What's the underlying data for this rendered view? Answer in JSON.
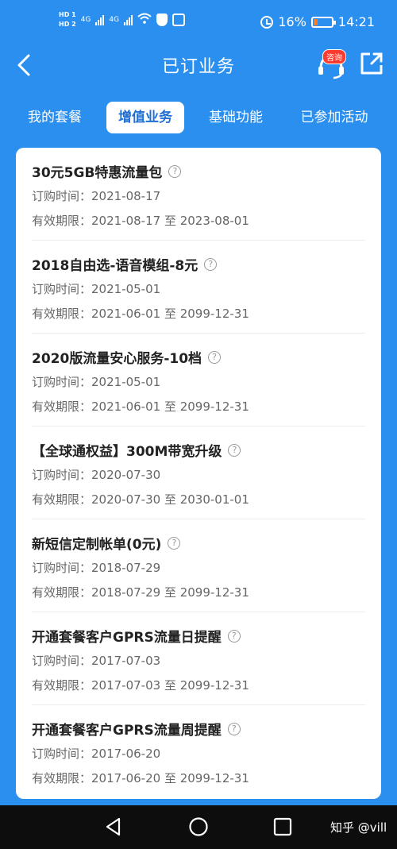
{
  "status_bar": {
    "hd1": "HD 1",
    "hd2": "HD 2",
    "network1": "4G",
    "network2": "4G",
    "battery_percent": "16%",
    "time": "14:21"
  },
  "header": {
    "title": "已订业务",
    "consult_badge": "咨询"
  },
  "tabs": [
    {
      "label": "我的套餐",
      "active": false
    },
    {
      "label": "增值业务",
      "active": true
    },
    {
      "label": "基础功能",
      "active": false
    },
    {
      "label": "已参加活动",
      "active": false
    }
  ],
  "services": [
    {
      "name": "30元5GB特惠流量包",
      "order_time": "订购时间：2021-08-17",
      "validity": "有效期限：2021-08-17 至 2023-08-01"
    },
    {
      "name": "2018自由选-语音模组-8元",
      "order_time": "订购时间：2021-05-01",
      "validity": "有效期限：2021-06-01 至 2099-12-31"
    },
    {
      "name": "2020版流量安心服务-10档",
      "order_time": "订购时间：2021-05-01",
      "validity": "有效期限：2021-06-01 至 2099-12-31"
    },
    {
      "name": "【全球通权益】300M带宽升级",
      "order_time": "订购时间：2020-07-30",
      "validity": "有效期限：2020-07-30 至 2030-01-01"
    },
    {
      "name": "新短信定制帐单(0元)",
      "order_time": "订购时间：2018-07-29",
      "validity": "有效期限：2018-07-29 至 2099-12-31"
    },
    {
      "name": "开通套餐客户GPRS流量日提醒",
      "order_time": "订购时间：2017-07-03",
      "validity": "有效期限：2017-07-03 至 2099-12-31"
    },
    {
      "name": "开通套餐客户GPRS流量周提醒",
      "order_time": "订购时间：2017-06-20",
      "validity": "有效期限：2017-06-20 至 2099-12-31"
    }
  ],
  "help_glyph": "?",
  "watermark": "知乎 @vill",
  "colors": {
    "background": "#2b8ff0",
    "active_tab_text": "#1e6fd6",
    "navbar": "#0d0d0d"
  }
}
